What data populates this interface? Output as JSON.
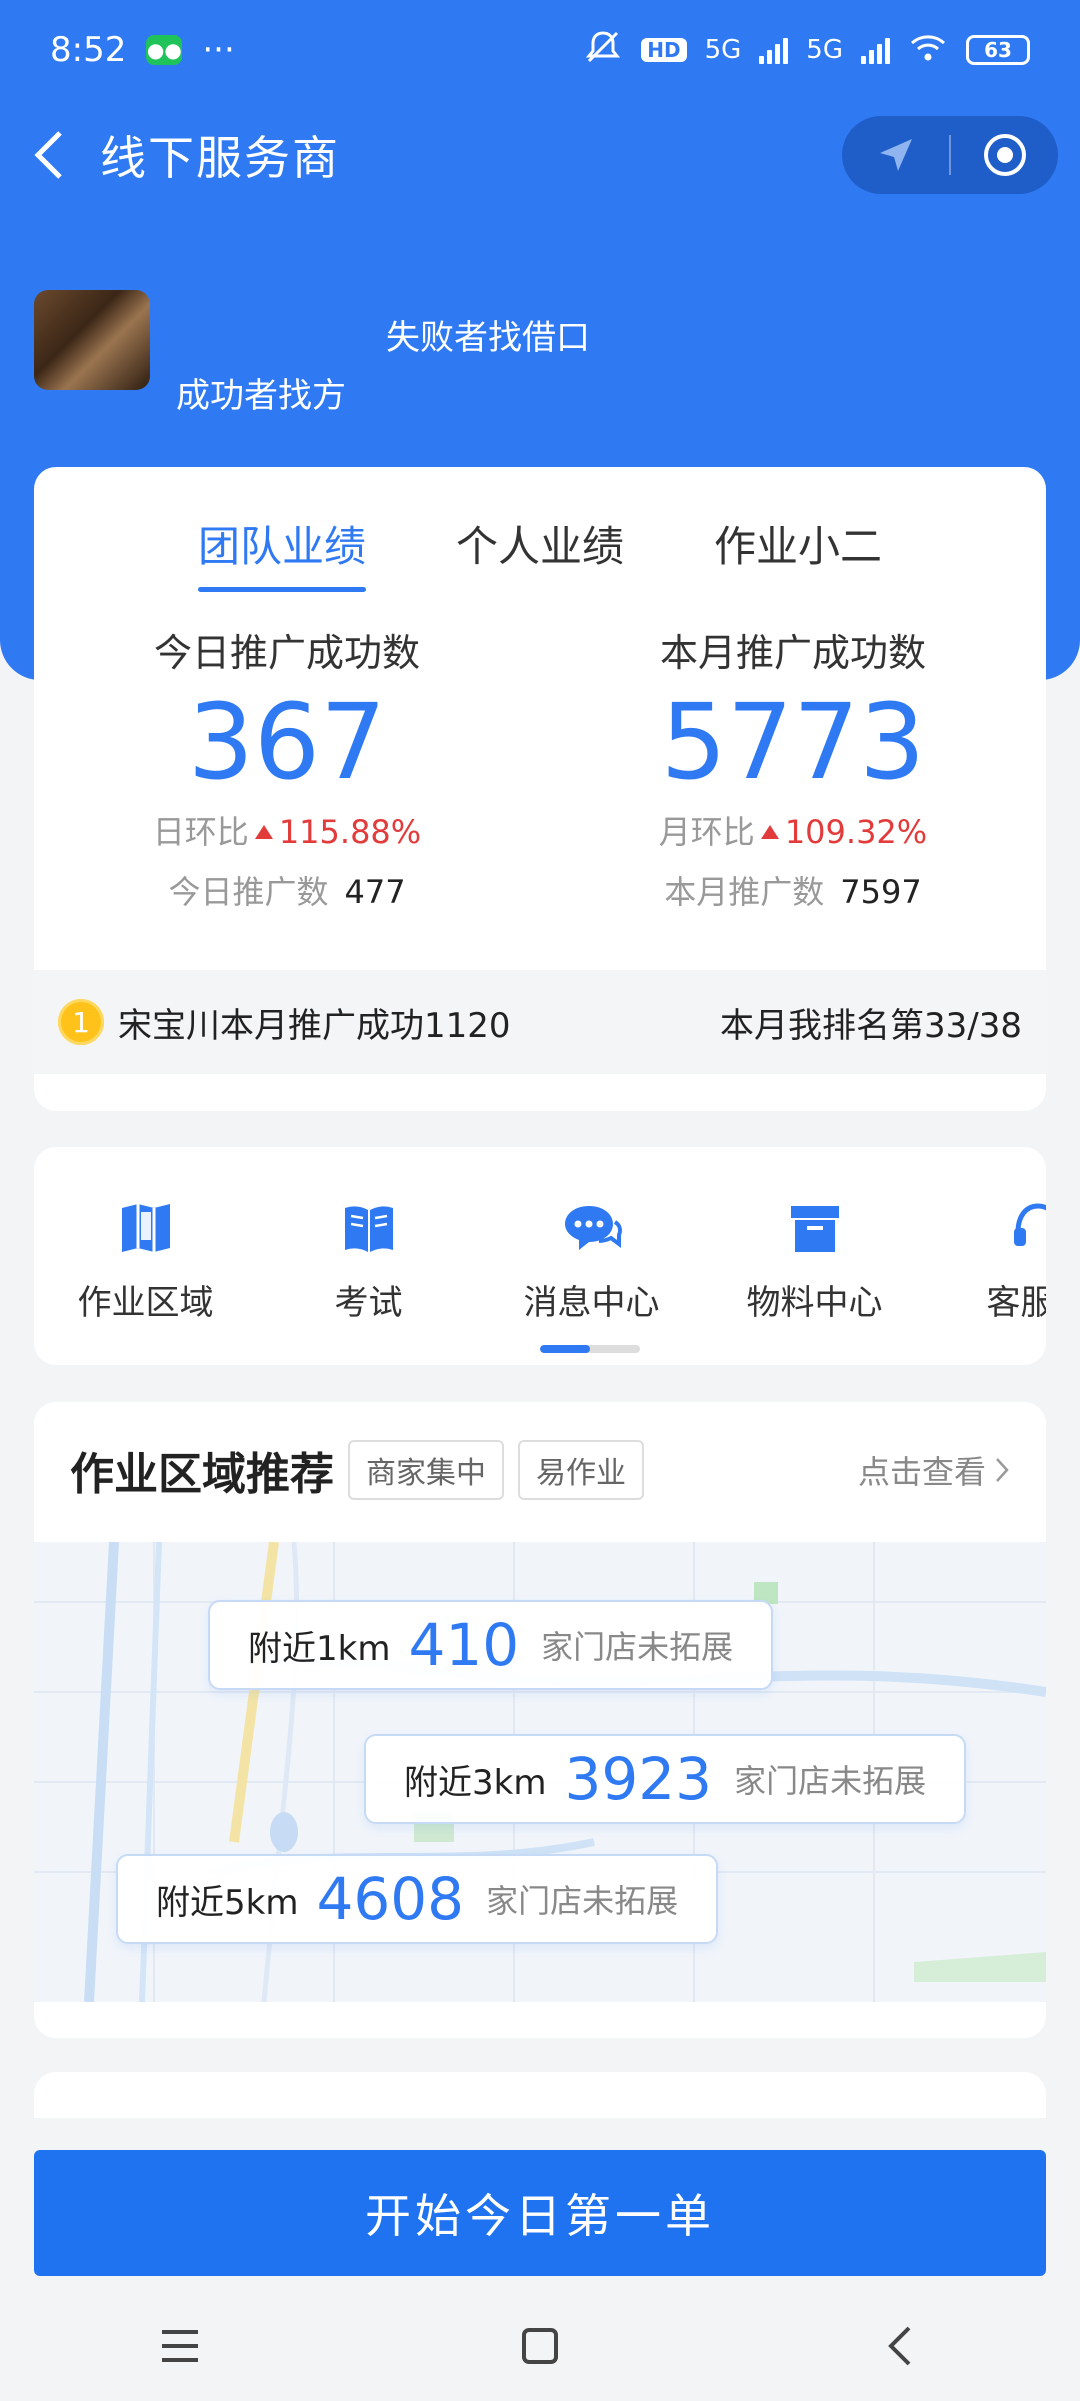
{
  "status_bar": {
    "time": "8:52",
    "more": "···",
    "hd": "HD",
    "net1": "5G",
    "net2": "5G",
    "battery": "63"
  },
  "header": {
    "title": "线下服务商"
  },
  "profile": {
    "slogan_1": "失败者找借口",
    "slogan_2": "成功者找方"
  },
  "performance": {
    "tabs": [
      {
        "label": "团队业绩",
        "active": true
      },
      {
        "label": "个人业绩",
        "active": false
      },
      {
        "label": "作业小二",
        "active": false
      }
    ],
    "today": {
      "label": "今日推广成功数",
      "value": "367",
      "ratio_label": "日环比",
      "ratio_value": "115.88%",
      "count_label": "今日推广数",
      "count_value": "477"
    },
    "month": {
      "label": "本月推广成功数",
      "value": "5773",
      "ratio_label": "月环比",
      "ratio_value": "109.32%",
      "count_label": "本月推广数",
      "count_value": "7597"
    },
    "rank": {
      "medal": "1",
      "leader_text": "宋宝川本月推广成功1120",
      "my_rank_text": "本月我排名第33/38"
    }
  },
  "menu": {
    "items": [
      {
        "label": "作业区域",
        "icon": "map-book-icon"
      },
      {
        "label": "考试",
        "icon": "open-book-icon"
      },
      {
        "label": "消息中心",
        "icon": "chat-bubbles-icon"
      },
      {
        "label": "物料中心",
        "icon": "archive-box-icon"
      },
      {
        "label": "客服中",
        "icon": "headset-icon"
      }
    ],
    "scroll_position": 0.5
  },
  "area": {
    "title": "作业区域推荐",
    "tags": [
      "商家集中",
      "易作业"
    ],
    "more_label": "点击查看",
    "nearby": [
      {
        "label": "附近1km",
        "count": "410",
        "suffix": "家门店未拓展"
      },
      {
        "label": "附近3km",
        "count": "3923",
        "suffix": "家门店未拓展"
      },
      {
        "label": "附近5km",
        "count": "4608",
        "suffix": "家门店未拓展"
      }
    ]
  },
  "cta": {
    "label": "开始今日第一单"
  },
  "colors": {
    "brand_blue": "#2f7af3",
    "up_red": "#e23b3b",
    "medal_gold": "#ffc21a"
  }
}
